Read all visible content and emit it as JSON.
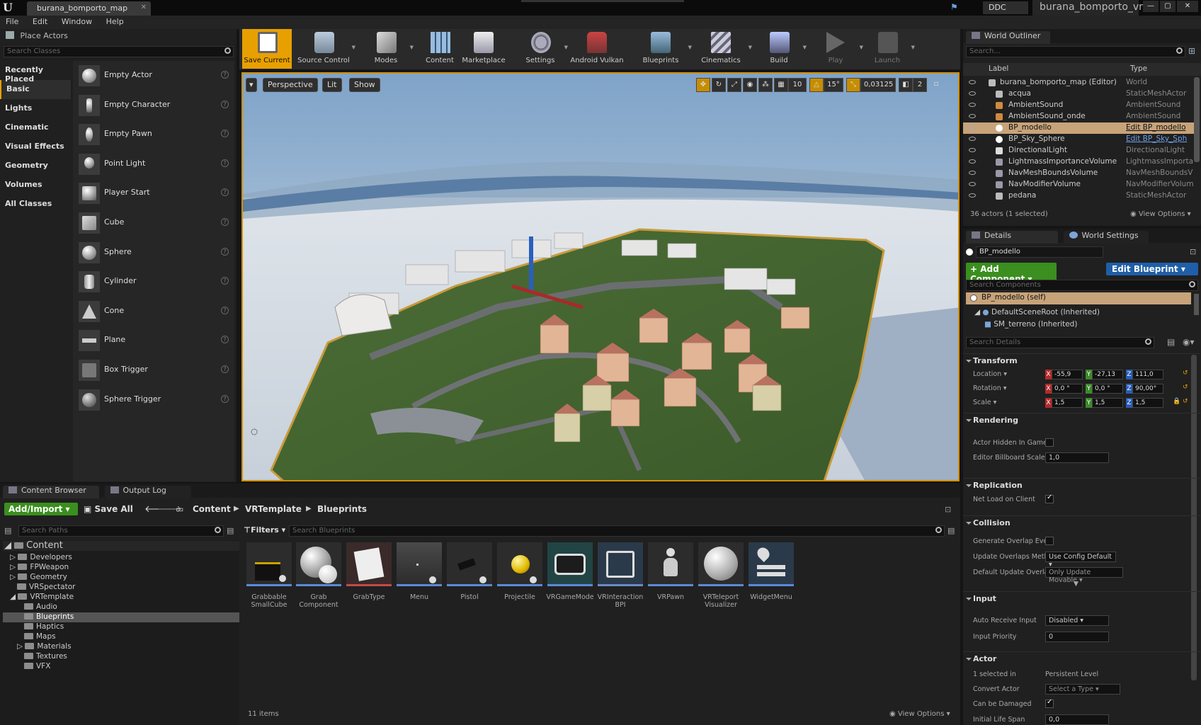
{
  "window": {
    "doc_tab": "burana_bomporto_map",
    "ddc": "DDC",
    "project_name": "burana_bomporto_vr"
  },
  "menu": [
    "File",
    "Edit",
    "Window",
    "Help"
  ],
  "place_actors": {
    "tab_label": "Place Actors",
    "search_placeholder": "Search Classes",
    "categories": [
      "Recently Placed",
      "Basic",
      "Lights",
      "Cinematic",
      "Visual Effects",
      "Geometry",
      "Volumes",
      "All Classes"
    ],
    "selected_category": "Basic",
    "actors": [
      "Empty Actor",
      "Empty Character",
      "Empty Pawn",
      "Point Light",
      "Player Start",
      "Cube",
      "Sphere",
      "Cylinder",
      "Cone",
      "Plane",
      "Box Trigger",
      "Sphere Trigger"
    ]
  },
  "toolbar": {
    "buttons": [
      "Save Current",
      "Source Control",
      "Modes",
      "Content",
      "Marketplace",
      "Settings",
      "Android Vulkan",
      "Blueprints",
      "Cinematics",
      "Build",
      "Play",
      "Launch"
    ]
  },
  "viewport": {
    "view_mode": "Perspective",
    "lit": "Lit",
    "show": "Show",
    "grid_snap": "10",
    "rotation_snap": "15°",
    "scale_snap": "0,03125",
    "camera_speed": "2"
  },
  "outliner": {
    "tab_label": "World Outliner",
    "search_placeholder": "Search...",
    "col_label": "Label",
    "col_type": "Type",
    "rows": [
      {
        "label": "burana_bomporto_map (Editor)",
        "type": "World"
      },
      {
        "label": "acqua",
        "type": "StaticMeshActor"
      },
      {
        "label": "AmbientSound",
        "type": "AmbientSound"
      },
      {
        "label": "AmbientSound_onde",
        "type": "AmbientSound"
      },
      {
        "label": "BP_modello",
        "type": "Edit BP_modello"
      },
      {
        "label": "BP_Sky_Sphere",
        "type": "Edit BP_Sky_Sph"
      },
      {
        "label": "DirectionalLight",
        "type": "DirectionalLight"
      },
      {
        "label": "LightmassImportanceVolume",
        "type": "LightmassImporta"
      },
      {
        "label": "NavMeshBoundsVolume",
        "type": "NavMeshBoundsV"
      },
      {
        "label": "NavModifierVolume",
        "type": "NavModifierVolum"
      },
      {
        "label": "pedana",
        "type": "StaticMeshActor"
      }
    ],
    "footer": "36 actors (1 selected)",
    "view_options": "View Options"
  },
  "details": {
    "tab_details": "Details",
    "tab_world": "World Settings",
    "name": "BP_modello",
    "add_component": "+ Add Component",
    "edit_blueprint": "Edit Blueprint",
    "search_components": "Search Components",
    "comp_self": "BP_modello (self)",
    "comp_root": "DefaultSceneRoot (Inherited)",
    "comp_mesh": "SM_terreno (Inherited)",
    "search_details": "Search Details",
    "sections": {
      "transform": "Transform",
      "rendering": "Rendering",
      "replication": "Replication",
      "collision": "Collision",
      "input": "Input",
      "actor": "Actor"
    },
    "location_label": "Location",
    "rotation_label": "Rotation",
    "scale_label": "Scale",
    "location": [
      "-55,9",
      "-27,13",
      "111,0"
    ],
    "rotation": [
      "0,0 °",
      "0,0 °",
      "90,00°"
    ],
    "scale": [
      "1,5",
      "1,5",
      "1,5"
    ],
    "actor_hidden": "Actor Hidden In Game",
    "billboard_label": "Editor Billboard Scale",
    "billboard_value": "1,0",
    "net_load": "Net Load on Client",
    "gen_overlap": "Generate Overlap Even",
    "upd_overlap": "Update Overlaps Meth",
    "upd_overlap_val": "Use Config Default",
    "def_upd_overlap": "Default Update Overla",
    "def_upd_overlap_val": "Only Update Movable",
    "auto_input": "Auto Receive Input",
    "auto_input_val": "Disabled",
    "input_priority": "Input Priority",
    "input_priority_val": "0",
    "selected_in": "1 selected in",
    "selected_in_val": "Persistent Level",
    "convert_actor": "Convert Actor",
    "convert_actor_val": "Select a Type",
    "can_be_damaged": "Can be Damaged",
    "life_span": "Initial Life Span",
    "life_span_val": "0,0"
  },
  "content_browser": {
    "tab_cb": "Content Browser",
    "tab_log": "Output Log",
    "add_import": "Add/Import",
    "save_all": "Save All",
    "crumbs": [
      "Content",
      "VRTemplate",
      "Blueprints"
    ],
    "search_paths": "Search Paths",
    "filters": "Filters",
    "search_assets": "Search Blueprints",
    "tree": [
      {
        "label": "Content",
        "level": 0
      },
      {
        "label": "Developers",
        "level": 1
      },
      {
        "label": "FPWeapon",
        "level": 1
      },
      {
        "label": "Geometry",
        "level": 1
      },
      {
        "label": "VRSpectator",
        "level": 1
      },
      {
        "label": "VRTemplate",
        "level": 1
      },
      {
        "label": "Audio",
        "level": 2
      },
      {
        "label": "Blueprints",
        "level": 2
      },
      {
        "label": "Haptics",
        "level": 2
      },
      {
        "label": "Maps",
        "level": 2
      },
      {
        "label": "Materials",
        "level": 2
      },
      {
        "label": "Textures",
        "level": 2
      },
      {
        "label": "VFX",
        "level": 2
      }
    ],
    "assets": [
      "Grabbable SmallCube",
      "Grab Component",
      "GrabType",
      "Menu",
      "Pistol",
      "Projectile",
      "VRGameMode",
      "VRInteraction BPI",
      "VRPawn",
      "VRTeleport Visualizer",
      "WidgetMenu"
    ],
    "item_count": "11 items",
    "view_options": "View Options"
  },
  "colors": {
    "accent": "#e8a000",
    "selection": "#c7a37a",
    "green": "#3a8f1e",
    "blue": "#1f5ea8"
  }
}
